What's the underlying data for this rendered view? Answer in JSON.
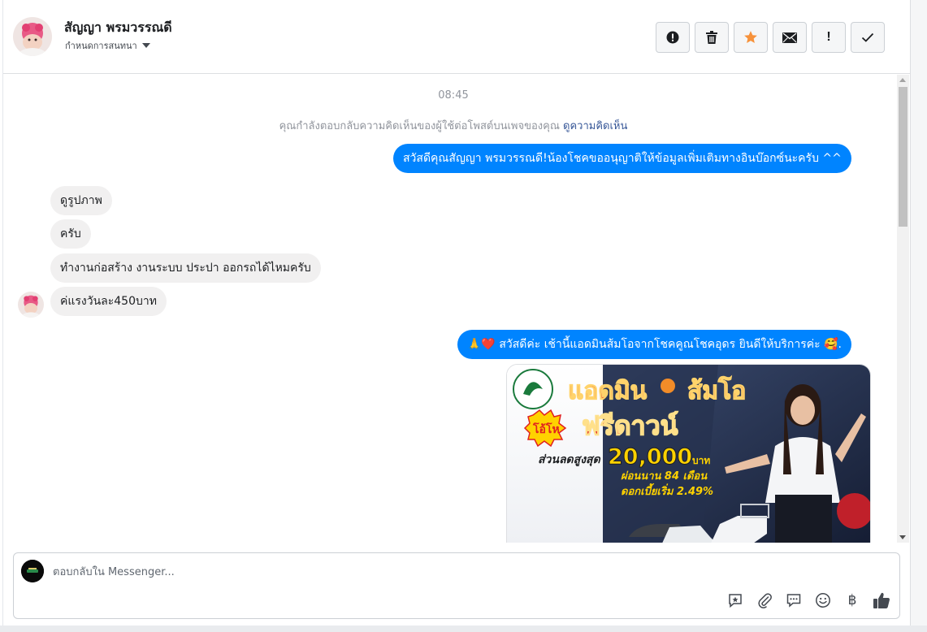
{
  "header": {
    "contact_name": "สัญญา พรมวรรณดี",
    "assign_label": "กำหนดการสนทนา",
    "toolbar": [
      {
        "name": "spam-report-icon"
      },
      {
        "name": "trash-icon"
      },
      {
        "name": "star-icon",
        "color": "#f7923b"
      },
      {
        "name": "envelope-icon"
      },
      {
        "name": "exclamation-mark",
        "label": "!"
      },
      {
        "name": "checkmark-icon"
      }
    ]
  },
  "conversation": {
    "timestamp": "08:45",
    "notice_text": "คุณกำลังตอบกลับความคิดเห็นของผู้ใช้ต่อโพสต์บนเพจของคุณ",
    "notice_link": "ดูความคิดเห็น",
    "messages": [
      {
        "direction": "outgoing",
        "text": "สวัสดีคุณสัญญา พรมวรรณดี!น้องโชคขออนุญาติให้ข้อมูลเพิ่มเติมทางอินบ๊อกซ์นะครับ ^^"
      },
      {
        "direction": "incoming",
        "text": "ดูรูปภาพ"
      },
      {
        "direction": "incoming",
        "text": "ครับ"
      },
      {
        "direction": "incoming",
        "text": "ทำงานก่อสร้าง งานระบบ ประปา ออกรถได้ไหมครับ"
      },
      {
        "direction": "incoming",
        "text": "ค่แรงวันละ450บาท"
      },
      {
        "direction": "outgoing",
        "text": "🙏❤️ สวัสดีค่ะ เช้านี้แอดมินส้มโอจากโชคคูณโชคอุดร ยินดีให้บริการค่ะ 🥰."
      }
    ],
    "promo_image": {
      "headline": "แอดมิน",
      "headline_name": "ส้มโอ",
      "burst": "โอ้โห",
      "offer": "ฟรีดาวน์",
      "discount_label": "ส่วนลดสูงสุด",
      "discount_amount": "20,000",
      "discount_unit": "บาท",
      "installment": "ผ่อนนาน 84 เดือน",
      "interest": "ดอกเบี้ยเริ่ม 2.49%"
    }
  },
  "composer": {
    "placeholder": "ตอบกลับใน Messenger...",
    "tools": [
      "saved-reply-icon",
      "attachment-icon",
      "chat-bubble-icon",
      "emoji-icon",
      "baht-icon",
      "thumbs-up-icon"
    ],
    "baht_symbol": "฿"
  },
  "colors": {
    "outgoing_bubble": "#0084ff",
    "incoming_bubble": "#f1f0f0",
    "link": "#385898",
    "star": "#f7923b"
  }
}
